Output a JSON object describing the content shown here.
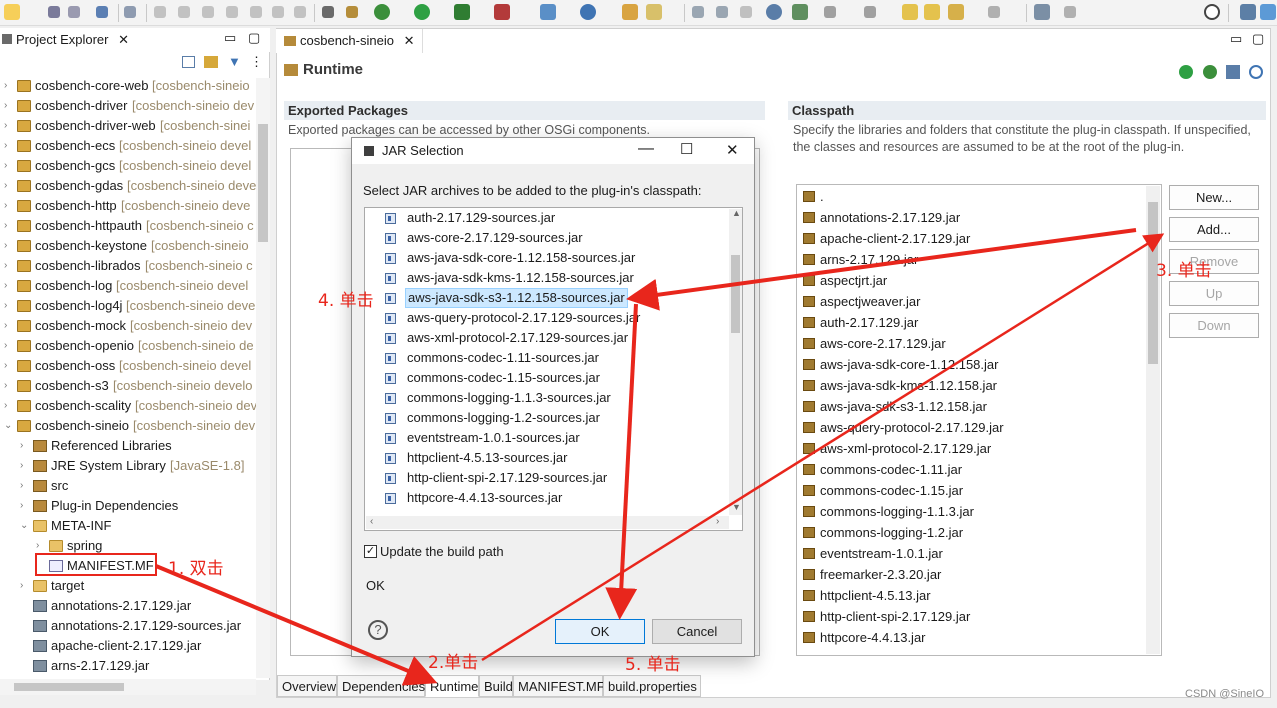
{
  "explorer": {
    "title": "Project Explorer",
    "items": [
      {
        "label": "cosbench-core-web",
        "decoration": "[cosbench-sineio",
        "kind": "project",
        "indent": 0,
        "chevron": ">"
      },
      {
        "label": "cosbench-driver",
        "decoration": "[cosbench-sineio dev",
        "kind": "project",
        "indent": 0,
        "chevron": ">"
      },
      {
        "label": "cosbench-driver-web",
        "decoration": "[cosbench-sinei",
        "kind": "project",
        "indent": 0,
        "chevron": ">"
      },
      {
        "label": "cosbench-ecs",
        "decoration": "[cosbench-sineio devel",
        "kind": "project",
        "indent": 0,
        "chevron": ">"
      },
      {
        "label": "cosbench-gcs",
        "decoration": "[cosbench-sineio devel",
        "kind": "project",
        "indent": 0,
        "chevron": ">"
      },
      {
        "label": "cosbench-gdas",
        "decoration": "[cosbench-sineio deve",
        "kind": "project",
        "indent": 0,
        "chevron": ">"
      },
      {
        "label": "cosbench-http",
        "decoration": "[cosbench-sineio deve",
        "kind": "project",
        "indent": 0,
        "chevron": ">"
      },
      {
        "label": "cosbench-httpauth",
        "decoration": "[cosbench-sineio c",
        "kind": "project",
        "indent": 0,
        "chevron": ">"
      },
      {
        "label": "cosbench-keystone",
        "decoration": "[cosbench-sineio",
        "kind": "project",
        "indent": 0,
        "chevron": ">"
      },
      {
        "label": "cosbench-librados",
        "decoration": "[cosbench-sineio c",
        "kind": "project",
        "indent": 0,
        "chevron": ">"
      },
      {
        "label": "cosbench-log",
        "decoration": "[cosbench-sineio devel",
        "kind": "project",
        "indent": 0,
        "chevron": ">"
      },
      {
        "label": "cosbench-log4j",
        "decoration": "[cosbench-sineio deve",
        "kind": "project",
        "indent": 0,
        "chevron": ">"
      },
      {
        "label": "cosbench-mock",
        "decoration": "[cosbench-sineio dev",
        "kind": "project",
        "indent": 0,
        "chevron": ">"
      },
      {
        "label": "cosbench-openio",
        "decoration": "[cosbench-sineio de",
        "kind": "project",
        "indent": 0,
        "chevron": ">"
      },
      {
        "label": "cosbench-oss",
        "decoration": "[cosbench-sineio devel",
        "kind": "project",
        "indent": 0,
        "chevron": ">"
      },
      {
        "label": "cosbench-s3",
        "decoration": "[cosbench-sineio develo",
        "kind": "project",
        "indent": 0,
        "chevron": ">"
      },
      {
        "label": "cosbench-scality",
        "decoration": "[cosbench-sineio deve",
        "kind": "project",
        "indent": 0,
        "chevron": ">"
      },
      {
        "label": "cosbench-sineio",
        "decoration": "[cosbench-sineio dev",
        "kind": "project",
        "indent": 0,
        "chevron": "v"
      },
      {
        "label": "Referenced Libraries",
        "decoration": "",
        "kind": "lib",
        "indent": 1,
        "chevron": ">"
      },
      {
        "label": "JRE System Library",
        "decoration": "[JavaSE-1.8]",
        "kind": "lib",
        "indent": 1,
        "chevron": ">"
      },
      {
        "label": "src",
        "decoration": "",
        "kind": "lib",
        "indent": 1,
        "chevron": ">"
      },
      {
        "label": "Plug-in Dependencies",
        "decoration": "",
        "kind": "lib",
        "indent": 1,
        "chevron": ">"
      },
      {
        "label": "META-INF",
        "decoration": "",
        "kind": "folder",
        "indent": 1,
        "chevron": "v"
      },
      {
        "label": "spring",
        "decoration": "",
        "kind": "folder",
        "indent": 2,
        "chevron": ">"
      },
      {
        "label": "MANIFEST.MF",
        "decoration": "",
        "kind": "manifest",
        "indent": 2,
        "chevron": ""
      },
      {
        "label": "target",
        "decoration": "",
        "kind": "folder",
        "indent": 1,
        "chevron": ">"
      },
      {
        "label": "annotations-2.17.129.jar",
        "decoration": "",
        "kind": "jar",
        "indent": 1,
        "chevron": ""
      },
      {
        "label": "annotations-2.17.129-sources.jar",
        "decoration": "",
        "kind": "jar",
        "indent": 1,
        "chevron": ""
      },
      {
        "label": "apache-client-2.17.129.jar",
        "decoration": "",
        "kind": "jar",
        "indent": 1,
        "chevron": ""
      },
      {
        "label": "arns-2.17.129.jar",
        "decoration": "",
        "kind": "jar",
        "indent": 1,
        "chevron": ""
      }
    ]
  },
  "editor": {
    "tab": "cosbench-sineio",
    "page_title": "Runtime",
    "exported": {
      "title": "Exported Packages",
      "desc": "Exported packages can be accessed by other OSGi components."
    },
    "classpath": {
      "title": "Classpath",
      "desc": "Specify the libraries and folders that constitute the plug-in classpath.  If unspecified, the classes and resources are assumed to be at the root of the plug-in.",
      "items": [
        ".",
        "annotations-2.17.129.jar",
        "apache-client-2.17.129.jar",
        "arns-2.17.129.jar",
        "aspectjrt.jar",
        "aspectjweaver.jar",
        "auth-2.17.129.jar",
        "aws-core-2.17.129.jar",
        "aws-java-sdk-core-1.12.158.jar",
        "aws-java-sdk-kms-1.12.158.jar",
        "aws-java-sdk-s3-1.12.158.jar",
        "aws-query-protocol-2.17.129.jar",
        "aws-xml-protocol-2.17.129.jar",
        "commons-codec-1.11.jar",
        "commons-codec-1.15.jar",
        "commons-logging-1.1.3.jar",
        "commons-logging-1.2.jar",
        "eventstream-1.0.1.jar",
        "freemarker-2.3.20.jar",
        "httpclient-4.5.13.jar",
        "http-client-spi-2.17.129.jar",
        "httpcore-4.4.13.jar"
      ],
      "buttons": {
        "new": "New...",
        "add": "Add...",
        "remove": "Remove",
        "up": "Up",
        "down": "Down"
      }
    },
    "bottom_tabs": [
      "Overview",
      "Dependencies",
      "Runtime",
      "Build",
      "MANIFEST.MF",
      "build.properties"
    ],
    "active_tab": "Runtime"
  },
  "dialog": {
    "title": "JAR Selection",
    "prompt": "Select JAR archives to be added to the plug-in's classpath:",
    "items": [
      "auth-2.17.129-sources.jar",
      "aws-core-2.17.129-sources.jar",
      "aws-java-sdk-core-1.12.158-sources.jar",
      "aws-java-sdk-kms-1.12.158-sources.jar",
      "aws-java-sdk-s3-1.12.158-sources.jar",
      "aws-query-protocol-2.17.129-sources.jar",
      "aws-xml-protocol-2.17.129-sources.jar",
      "commons-codec-1.11-sources.jar",
      "commons-codec-1.15-sources.jar",
      "commons-logging-1.1.3-sources.jar",
      "commons-logging-1.2-sources.jar",
      "eventstream-1.0.1-sources.jar",
      "httpclient-4.5.13-sources.jar",
      "http-client-spi-2.17.129-sources.jar",
      "httpcore-4.4.13-sources.jar"
    ],
    "selected_index": 4,
    "checkbox_label": "Update the build path",
    "checkbox_checked": true,
    "status": "OK",
    "ok": "OK",
    "cancel": "Cancel",
    "help": "?"
  },
  "annotations": {
    "step1": "1. 双击",
    "step2": "2.单击",
    "step3": "3. 单击",
    "step4": "4. 单击",
    "step5": "5. 单击"
  },
  "watermark": "CSDN @SineIO"
}
